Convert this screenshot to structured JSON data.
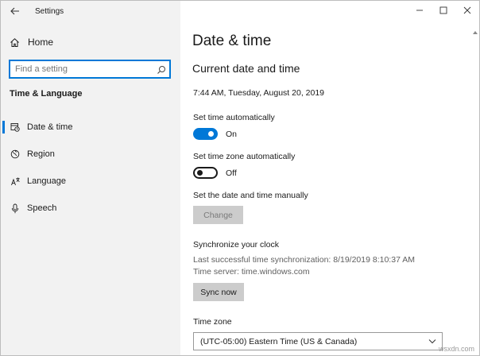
{
  "app": {
    "title": "Settings"
  },
  "sidebar": {
    "home_label": "Home",
    "search_placeholder": "Find a setting",
    "section_heading": "Time & Language",
    "items": [
      {
        "label": "Date & time",
        "icon": "date-time-icon",
        "active": true
      },
      {
        "label": "Region",
        "icon": "globe-icon",
        "active": false
      },
      {
        "label": "Language",
        "icon": "language-icon",
        "active": false
      },
      {
        "label": "Speech",
        "icon": "microphone-icon",
        "active": false
      }
    ]
  },
  "main": {
    "title": "Date & time",
    "subheading": "Current date and time",
    "current_datetime": "7:44 AM, Tuesday, August 20, 2019",
    "set_time_auto": {
      "label": "Set time automatically",
      "state": "On",
      "on": true
    },
    "set_timezone_auto": {
      "label": "Set time zone automatically",
      "state": "Off",
      "on": false
    },
    "manual": {
      "label": "Set the date and time manually",
      "button": "Change"
    },
    "sync": {
      "heading": "Synchronize your clock",
      "last_sync": "Last successful time synchronization: 8/19/2019 8:10:37 AM",
      "server": "Time server: time.windows.com",
      "button": "Sync now"
    },
    "timezone": {
      "label": "Time zone",
      "selected": "(UTC-05:00) Eastern Time (US & Canada)"
    }
  },
  "watermark": "wsxdn.com",
  "colors": {
    "accent": "#0078d7",
    "sidebar_bg": "#f2f2f2",
    "button_bg": "#cccccc"
  }
}
